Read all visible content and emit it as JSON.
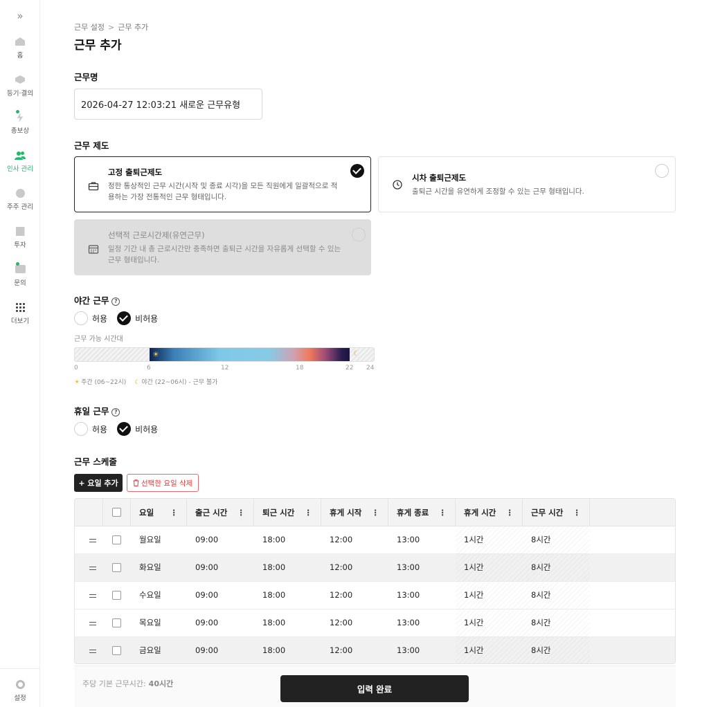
{
  "sidebar": {
    "items": [
      {
        "label": "홈"
      },
      {
        "label": "등기·결의"
      },
      {
        "label": "총보상"
      },
      {
        "label": "인사 관리"
      },
      {
        "label": "주주 관리"
      },
      {
        "label": "투자"
      },
      {
        "label": "문의"
      },
      {
        "label": "더보기"
      }
    ],
    "settings_label": "설정",
    "accent_color": "#1fb96b"
  },
  "breadcrumb": {
    "parent": "근무 설정",
    "separator": ">",
    "current": "근무 추가"
  },
  "page_title": "근무 추가",
  "work_name": {
    "label": "근무명",
    "value": "2026-04-27 12:03:21 새로운 근무유형"
  },
  "work_system": {
    "label": "근무 제도",
    "options": [
      {
        "title": "고정 출퇴근제도",
        "desc": "정한 통상적인 근무 시간(시작 및 종료 시각)을 모든 직원에게 일괄적으로 적용하는 가장 전통적인 근무 형태입니다.",
        "selected": true
      },
      {
        "title": "시차 출퇴근제도",
        "desc": "출퇴근 시간을 유연하게 조정할 수 있는 근무 형태입니다.",
        "selected": false
      },
      {
        "title": "선택적 근로시간제(유연근무)",
        "desc": "일정 기간 내 총 근로시간만 충족하면 출퇴근 시간을 자유롭게 선택할 수 있는 근무 형태입니다.",
        "selected": false,
        "disabled": true
      }
    ]
  },
  "night_work": {
    "label": "야간 근무",
    "allow_label": "허용",
    "deny_label": "비허용",
    "selected": "deny",
    "range_caption": "근무 가능 시간대",
    "ticks": [
      "0",
      "6",
      "12",
      "18",
      "22",
      "24"
    ],
    "day_range": [
      6,
      22
    ],
    "legend_day": "주간 (06~22시)",
    "legend_night": "야간 (22~06시) - 근무 불가"
  },
  "holiday_work": {
    "label": "휴일 근무",
    "allow_label": "허용",
    "deny_label": "비허용",
    "selected": "deny"
  },
  "schedule": {
    "label": "근무 스케줄",
    "add_button": "+ 요일 추가",
    "delete_button": "선택한 요일 삭제",
    "columns": [
      "요일",
      "출근 시간",
      "퇴근 시간",
      "휴게 시작",
      "휴게 종료",
      "휴게 시간",
      "근무 시간"
    ],
    "rows": [
      {
        "day": "월요일",
        "start": "09:00",
        "end": "18:00",
        "break_start": "12:00",
        "break_end": "13:00",
        "break_time": "1시간",
        "work_time": "8시간"
      },
      {
        "day": "화요일",
        "start": "09:00",
        "end": "18:00",
        "break_start": "12:00",
        "break_end": "13:00",
        "break_time": "1시간",
        "work_time": "8시간"
      },
      {
        "day": "수요일",
        "start": "09:00",
        "end": "18:00",
        "break_start": "12:00",
        "break_end": "13:00",
        "break_time": "1시간",
        "work_time": "8시간"
      },
      {
        "day": "목요일",
        "start": "09:00",
        "end": "18:00",
        "break_start": "12:00",
        "break_end": "13:00",
        "break_time": "1시간",
        "work_time": "8시간"
      },
      {
        "day": "금요일",
        "start": "09:00",
        "end": "18:00",
        "break_start": "12:00",
        "break_end": "13:00",
        "break_time": "1시간",
        "work_time": "8시간"
      }
    ]
  },
  "footer": {
    "weekly_label": "주당 기본 근무시간:",
    "weekly_value": "40시간",
    "submit_label": "입력 완료"
  }
}
